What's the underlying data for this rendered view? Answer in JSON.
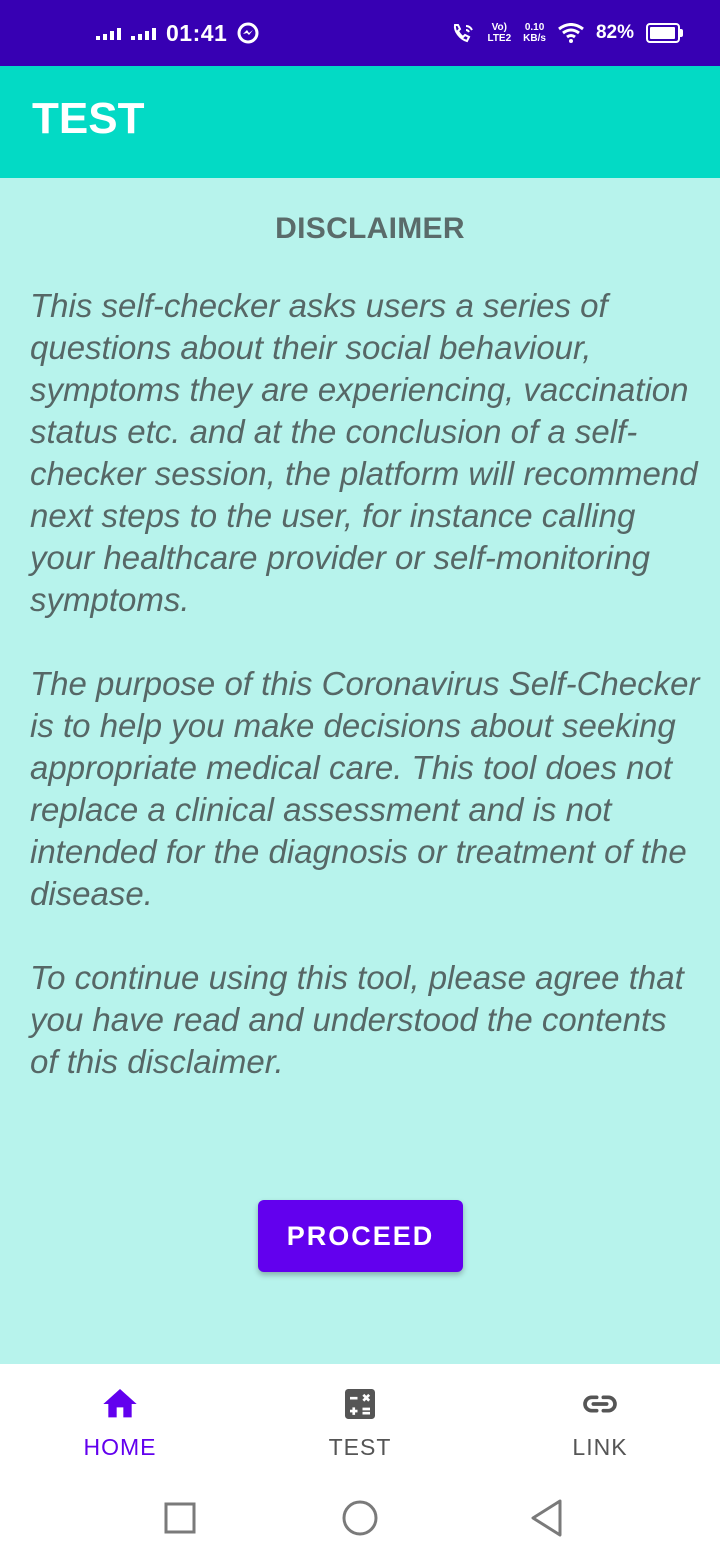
{
  "status_bar": {
    "time": "01:41",
    "volte_top": "Vo)",
    "volte_bottom": "LTE2",
    "speed_value": "0.10",
    "speed_unit": "KB/s",
    "battery": "82%"
  },
  "app_bar": {
    "title": "TEST"
  },
  "content": {
    "heading": "DISCLAIMER",
    "paragraphs": [
      "This self-checker asks users a series of questions about their social behaviour, symptoms they are experiencing, vaccination status etc. and at the conclusion of a self-checker session, the platform will recommend next steps to the user, for instance calling your healthcare provider or self-monitoring symptoms.",
      " The purpose of this Coronavirus Self-Checker is to help you make decisions about seeking appropriate medical care. This tool does not replace a clinical assessment and is not intended for the diagnosis or treatment of the disease.",
      " To continue using this tool, please agree that you have read and understood the contents of this disclaimer."
    ],
    "proceed_label": "PROCEED"
  },
  "bottom_nav": {
    "items": [
      {
        "label": "HOME",
        "icon": "home-icon",
        "active": true
      },
      {
        "label": "TEST",
        "icon": "calculator-icon",
        "active": false
      },
      {
        "label": "LINK",
        "icon": "link-icon",
        "active": false
      }
    ]
  },
  "colors": {
    "status_bar": "#3700b3",
    "app_bar": "#03dac5",
    "background": "#b7f3ec",
    "accent": "#6200ee",
    "body_text": "#566766"
  }
}
